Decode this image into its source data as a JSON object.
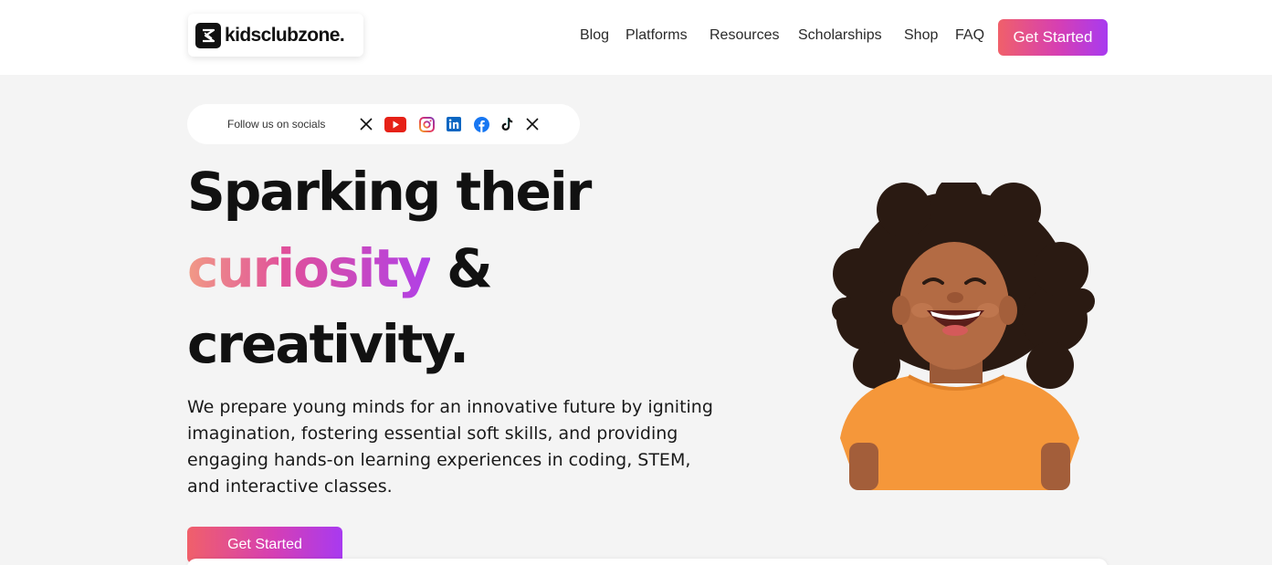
{
  "brand": {
    "name": "kidsclubzone."
  },
  "nav": {
    "items": [
      "Blog",
      "Platforms",
      "Resources",
      "Scholarships",
      "Shop",
      "FAQ"
    ],
    "cta_label": "Get Started"
  },
  "socials": {
    "label": "Follow us on socials",
    "icons": [
      "x-icon",
      "youtube-icon",
      "instagram-icon",
      "linkedin-icon",
      "facebook-icon",
      "tiktok-icon",
      "x-icon"
    ]
  },
  "hero": {
    "line1": "Sparking their",
    "line2_highlight": "curiosity",
    "line2_rest": " &",
    "line3": "creativity.",
    "description": "We prepare young minds for an innovative future by igniting imagination, fostering essential soft skills, and providing engaging hands-on learning experiences in coding, STEM, and interactive classes.",
    "cta_label": "Get Started"
  },
  "colors": {
    "gradient_start": "#f0606a",
    "gradient_mid": "#d63fb3",
    "gradient_end": "#a83af0",
    "background": "#f4f4f4",
    "shirt": "#f5973a"
  }
}
